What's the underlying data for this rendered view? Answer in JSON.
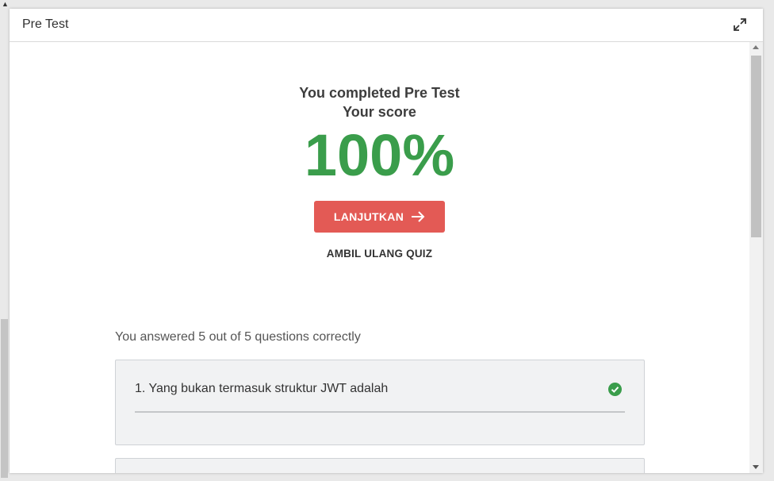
{
  "dialog": {
    "title": "Pre Test"
  },
  "result": {
    "completed_line": "You completed Pre Test",
    "score_label": "Your score",
    "score_value": "100%",
    "score_color": "#3a9d4b"
  },
  "actions": {
    "continue_label": "LANJUTKAN",
    "continue_color": "#e35a55",
    "retake_label": "AMBIL ULANG QUIZ"
  },
  "summary": {
    "answered_text": "You answered 5 out of 5 questions correctly"
  },
  "questions": [
    {
      "text": "1. Yang bukan termasuk struktur JWT adalah",
      "status": "correct",
      "icon": "check-circle-icon"
    }
  ],
  "icons": {
    "expand": "expand-icon",
    "continue_arrow": "arrow-right-icon"
  }
}
